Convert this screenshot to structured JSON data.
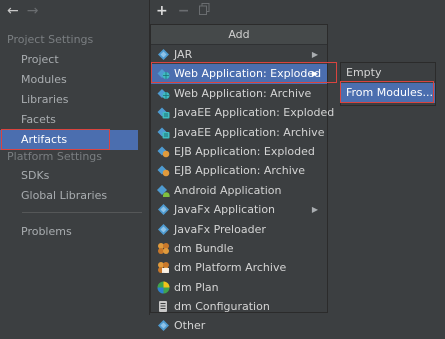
{
  "sidebar": {
    "back_glyph": "←",
    "forward_glyph": "→",
    "project_settings_label": "Project Settings",
    "platform_settings_label": "Platform Settings",
    "items": {
      "project": "Project",
      "modules": "Modules",
      "libraries": "Libraries",
      "facets": "Facets",
      "artifacts": "Artifacts",
      "sdks": "SDKs",
      "global_libraries": "Global Libraries",
      "problems": "Problems"
    },
    "selected": "Artifacts"
  },
  "toolbar": {
    "add_glyph": "+",
    "remove_glyph": "−",
    "copy_icon": "copy-icon"
  },
  "menu": {
    "title": "Add",
    "items": [
      {
        "label": "JAR",
        "icon": "diamond-icon",
        "submenu": true
      },
      {
        "label": "Web Application: Exploded",
        "icon": "web-app-icon",
        "submenu": true,
        "highlighted": true
      },
      {
        "label": "Web Application: Archive",
        "icon": "web-app-icon",
        "submenu": false
      },
      {
        "label": "JavaEE Application: Exploded",
        "icon": "javaee-icon",
        "submenu": false
      },
      {
        "label": "JavaEE Application: Archive",
        "icon": "javaee-icon",
        "submenu": false
      },
      {
        "label": "EJB Application: Exploded",
        "icon": "ejb-icon",
        "submenu": false
      },
      {
        "label": "EJB Application: Archive",
        "icon": "ejb-icon",
        "submenu": false
      },
      {
        "label": "Android Application",
        "icon": "android-icon",
        "submenu": false
      },
      {
        "label": "JavaFx Application",
        "icon": "diamond-icon",
        "submenu": true
      },
      {
        "label": "JavaFx Preloader",
        "icon": "diamond-icon",
        "submenu": false
      },
      {
        "label": "dm Bundle",
        "icon": "dm-bundle-icon",
        "submenu": false
      },
      {
        "label": "dm Platform Archive",
        "icon": "dm-platform-icon",
        "submenu": false
      },
      {
        "label": "dm Plan",
        "icon": "dm-plan-icon",
        "submenu": false
      },
      {
        "label": "dm Configuration",
        "icon": "dm-configuration-icon",
        "submenu": false
      },
      {
        "label": "Other",
        "icon": "diamond-icon",
        "submenu": false
      }
    ]
  },
  "submenu": {
    "items": [
      {
        "label": "Empty",
        "highlighted": false
      },
      {
        "label": "From Modules...",
        "highlighted": true
      }
    ]
  },
  "colors": {
    "background": "#3c3f41",
    "selection": "#4b6eaf",
    "annotation_red": "#d9443f",
    "icon_blue": "#4e9bd1",
    "icon_teal": "#3fbcc1",
    "icon_orange": "#e09a3c",
    "icon_green": "#7fbf3f"
  }
}
